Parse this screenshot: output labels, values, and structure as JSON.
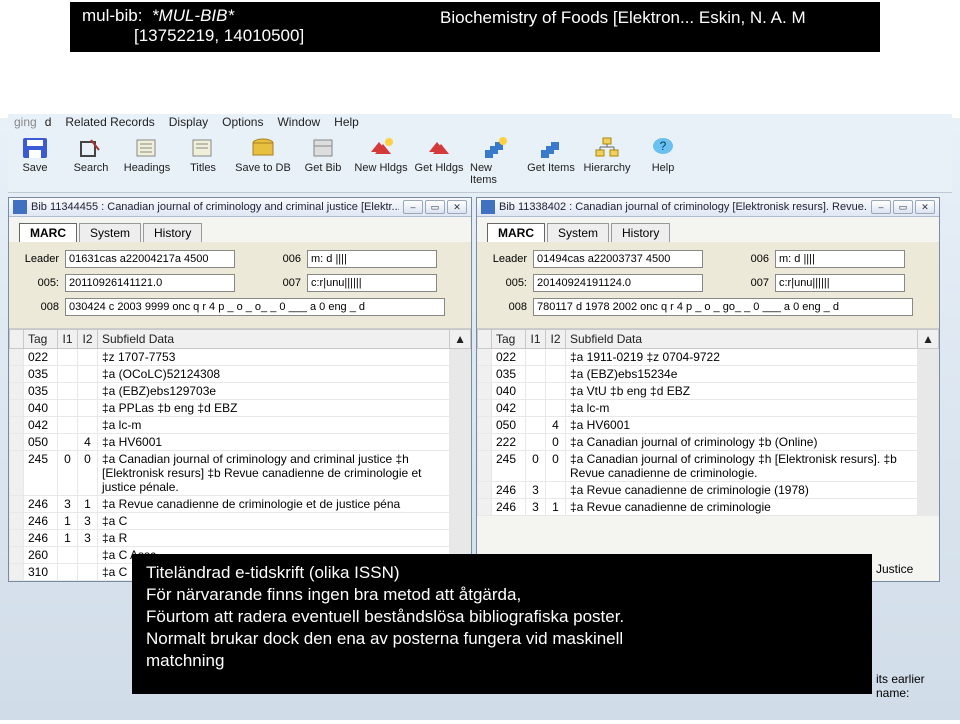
{
  "header": {
    "mulbib_label": "mul-bib:",
    "mulbib_val": "*MUL-BIB*",
    "title_right": "Biochemistry of Foods [Elektron... Eskin, N. A. M",
    "ids_line": "[13752219, 14010500]"
  },
  "menubar": [
    "ging",
    "d",
    "Related Records",
    "Display",
    "Options",
    "Window",
    "Help"
  ],
  "toolbar": [
    {
      "label": "Save",
      "icon": "save-icon"
    },
    {
      "label": "Search",
      "icon": "search-icon"
    },
    {
      "label": "Headings",
      "icon": "headings-icon"
    },
    {
      "label": "Titles",
      "icon": "titles-icon"
    },
    {
      "label": "Save to DB",
      "icon": "save-db-icon"
    },
    {
      "label": "Get Bib",
      "icon": "get-bib-icon"
    },
    {
      "label": "New Hldgs",
      "icon": "new-hldgs-icon"
    },
    {
      "label": "Get Hldgs",
      "icon": "get-hldgs-icon"
    },
    {
      "label": "New Items",
      "icon": "new-items-icon"
    },
    {
      "label": "Get Items",
      "icon": "get-items-icon"
    },
    {
      "label": "Hierarchy",
      "icon": "hierarchy-icon"
    },
    {
      "label": "Help",
      "icon": "help-icon"
    }
  ],
  "left_window": {
    "title": "Bib 11344455 : Canadian journal of criminology and criminal justice [Elektr...",
    "tabs": [
      "MARC",
      "System",
      "History"
    ],
    "fields": {
      "leader_label": "Leader",
      "leader": "01631cas a22004217a 4500",
      "f006_label": "006",
      "f006": "m: d ||||",
      "f005_label": "005:",
      "f005": "20110926141121.0",
      "f007_label": "007",
      "f007": "c:r|unu||||||",
      "f008_label": "008",
      "f008": "030424 c 2003 9999 onc q r 4 p _ o _ o_ _ 0 ___ a 0 eng _ d"
    },
    "grid_headers": {
      "tag": "Tag",
      "i1": "I1",
      "i2": "I2",
      "sd": "Subfield Data"
    },
    "rows": [
      {
        "tag": "022",
        "i1": "",
        "i2": "",
        "sd": "‡z 1707-7753"
      },
      {
        "tag": "035",
        "i1": "",
        "i2": "",
        "sd": "‡a (OCoLC)52124308"
      },
      {
        "tag": "035",
        "i1": "",
        "i2": "",
        "sd": "‡a (EBZ)ebs129703e"
      },
      {
        "tag": "040",
        "i1": "",
        "i2": "",
        "sd": "‡a PPLas ‡b eng ‡d EBZ"
      },
      {
        "tag": "042",
        "i1": "",
        "i2": "",
        "sd": "‡a lc-m"
      },
      {
        "tag": "050",
        "i1": "",
        "i2": "4",
        "sd": "‡a HV6001"
      },
      {
        "tag": "245",
        "i1": "0",
        "i2": "0",
        "sd": "‡a Canadian journal of criminology and criminal justice ‡h [Elektronisk resurs] ‡b Revue canadienne de criminologie et justice pénale."
      },
      {
        "tag": "246",
        "i1": "3",
        "i2": "1",
        "sd": "‡a Revue canadienne de criminologie et de justice péna"
      },
      {
        "tag": "246",
        "i1": "1",
        "i2": "3",
        "sd": "‡a C"
      },
      {
        "tag": "246",
        "i1": "1",
        "i2": "3",
        "sd": "‡a R"
      },
      {
        "tag": "260",
        "i1": "",
        "i2": "",
        "sd": "‡a C      Assc"
      },
      {
        "tag": "310",
        "i1": "",
        "i2": "",
        "sd": "‡a C"
      }
    ]
  },
  "right_window": {
    "title": "Bib 11338402 : Canadian journal of criminology [Elektronisk resurs]. Revue...",
    "tabs": [
      "MARC",
      "System",
      "History"
    ],
    "fields": {
      "leader_label": "Leader",
      "leader": "01494cas a22003737 4500",
      "f006_label": "006",
      "f006": "m: d ||||",
      "f005_label": "005:",
      "f005": "20140924191124.0",
      "f007_label": "007",
      "f007": "c:r|unu||||||",
      "f008_label": "008",
      "f008": "780117 d 1978 2002 onc q r 4 p _ o _ go_ _ 0 ___ a 0 eng _ d"
    },
    "grid_headers": {
      "tag": "Tag",
      "i1": "I1",
      "i2": "I2",
      "sd": "Subfield Data"
    },
    "rows": [
      {
        "tag": "022",
        "i1": "",
        "i2": "",
        "sd": "‡a 1911-0219 ‡z 0704-9722"
      },
      {
        "tag": "035",
        "i1": "",
        "i2": "",
        "sd": "‡a (EBZ)ebs15234e"
      },
      {
        "tag": "040",
        "i1": "",
        "i2": "",
        "sd": "‡a VtU ‡b eng ‡d EBZ"
      },
      {
        "tag": "042",
        "i1": "",
        "i2": "",
        "sd": "‡a lc-m"
      },
      {
        "tag": "050",
        "i1": "",
        "i2": "4",
        "sd": "‡a HV6001"
      },
      {
        "tag": "222",
        "i1": "",
        "i2": "0",
        "sd": "‡a Canadian journal of criminology ‡b (Online)"
      },
      {
        "tag": "245",
        "i1": "0",
        "i2": "0",
        "sd": "‡a Canadian journal of criminology ‡h [Elektronisk resurs]. ‡b Revue canadienne de criminologie."
      },
      {
        "tag": "246",
        "i1": "3",
        "i2": "",
        "sd": "‡a Revue canadienne de criminologie (1978)"
      },
      {
        "tag": "246",
        "i1": "3",
        "i2": "1",
        "sd": "‡a Revue canadienne de criminologie"
      }
    ],
    "extra_right_text": "Justice",
    "extra_right_text2": "its earlier name:"
  },
  "overlay": {
    "l1": "Titeländrad e-tidskrift (olika ISSN)",
    "l2": "För närvarande finns ingen bra metod att åtgärda,",
    "l3": "Föurtom att radera eventuell beståndslösa  bibliografiska poster.",
    "l4": "Normalt brukar dock den ena av posterna fungera vid maskinell",
    "l5": "matchning"
  }
}
